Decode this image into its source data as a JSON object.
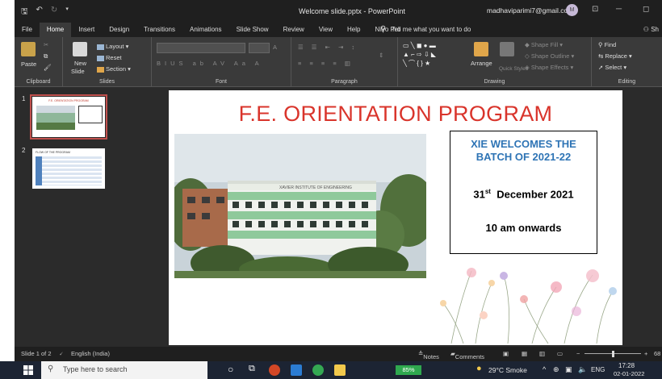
{
  "titlebar": {
    "doc_title": "Welcome slide.pptx  -  PowerPoint",
    "account": "madhaviparimi7@gmail.com",
    "avatar": "M"
  },
  "tabs": [
    "File",
    "Home",
    "Insert",
    "Design",
    "Transitions",
    "Animations",
    "Slide Show",
    "Review",
    "View",
    "Help",
    "Nitro Pro"
  ],
  "active_tab": "Home",
  "tell_me": "Tell me what you want to do",
  "share": "Sh",
  "ribbon": {
    "clipboard": {
      "label": "Clipboard",
      "paste": "Paste"
    },
    "slides": {
      "label": "Slides",
      "new_slide": "New",
      "new_slide2": "Slide",
      "layout": "Layout",
      "reset": "Reset",
      "section": "Section"
    },
    "font": {
      "label": "Font"
    },
    "paragraph": {
      "label": "Paragraph"
    },
    "drawing": {
      "label": "Drawing",
      "arrange": "Arrange",
      "quick_styles": "Quick Styles",
      "shape_fill": "Shape Fill",
      "shape_outline": "Shape Outline",
      "shape_effects": "Shape Effects"
    },
    "editing": {
      "label": "Editing",
      "find": "Find",
      "replace": "Replace",
      "select": "Select"
    }
  },
  "thumbnails": [
    {
      "num": "1",
      "title": "F.E. ORIENTATION PROGRAM",
      "selected": true
    },
    {
      "num": "2",
      "title": "FLOW OF THE PROGRAM",
      "selected": false
    }
  ],
  "slide": {
    "title": "F.E. ORIENTATION PROGRAM",
    "photo_sign": "XAVIER INSTITUTE OF ENGINEERING",
    "welcome_line1": "XIE WELCOMES THE",
    "welcome_line2": "BATCH OF 2021-22",
    "date_day": "31",
    "date_suffix": "st",
    "date_rest": "  December 2021",
    "time": "10 am onwards"
  },
  "statusbar": {
    "slide_count": "Slide 1 of 2",
    "language": "English (India)",
    "notes": "Notes",
    "comments": "Comments",
    "zoom": "68"
  },
  "taskbar": {
    "search_placeholder": "Type here to search",
    "battery": "85%",
    "weather": "29°C  Smoke",
    "lang": "ENG",
    "time": "17:28",
    "date": "02-01-2022"
  },
  "colors": {
    "title_red": "#d9342b",
    "welcome_blue": "#2e74b5",
    "selection_red": "#c0504d"
  }
}
